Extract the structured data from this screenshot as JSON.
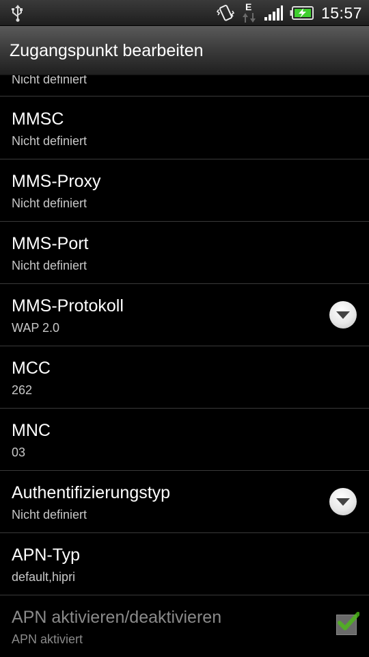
{
  "status_bar": {
    "time": "15:57",
    "network_type": "E"
  },
  "title_bar": {
    "title": "Zugangspunkt bearbeiten"
  },
  "list": {
    "partial_item": {
      "sub": "Nicht definiert"
    },
    "items": [
      {
        "label": "MMSC",
        "value": "Nicht definiert"
      },
      {
        "label": "MMS-Proxy",
        "value": "Nicht definiert"
      },
      {
        "label": "MMS-Port",
        "value": "Nicht definiert"
      },
      {
        "label": "MMS-Protokoll",
        "value": "WAP 2.0"
      },
      {
        "label": "MCC",
        "value": "262"
      },
      {
        "label": "MNC",
        "value": "03"
      },
      {
        "label": "Authentifizierungstyp",
        "value": "Nicht definiert"
      },
      {
        "label": "APN-Typ",
        "value": "default,hipri"
      },
      {
        "label": "APN aktivieren/deaktivieren",
        "value": "APN aktiviert",
        "checked": true
      }
    ]
  },
  "icons": {
    "usb": "usb-icon",
    "vibrate": "vibrate-icon",
    "data_transfer": "data-transfer-icon",
    "signal": "signal-icon",
    "battery": "battery-charging-icon",
    "dropdown": "chevron-down-icon",
    "checkbox": "checkbox-checked-icon"
  },
  "colors": {
    "background": "#000000",
    "divider": "#3a3a3a",
    "text_primary": "#ffffff",
    "text_secondary": "#c8c8c8",
    "text_disabled": "#8a8a8a",
    "battery_green": "#3fcf2f",
    "check_green": "#4cbb17"
  }
}
